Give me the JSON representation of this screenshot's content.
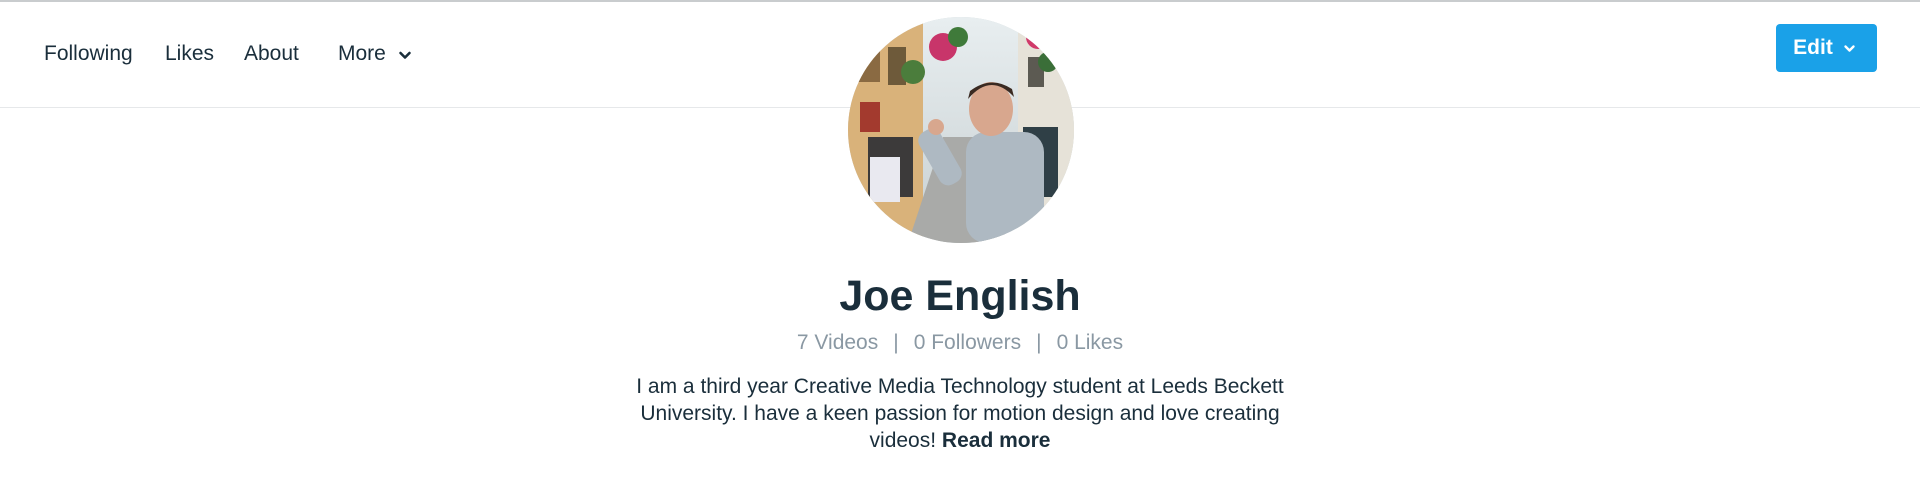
{
  "nav": {
    "following": "Following",
    "likes": "Likes",
    "about": "About",
    "more": "More"
  },
  "header": {
    "edit_label": "Edit"
  },
  "profile": {
    "name": "Joe English",
    "stats": {
      "videos": "7 Videos",
      "followers": "0 Followers",
      "likes": "0 Likes",
      "separator": "|"
    },
    "bio": "I am a third year Creative Media Technology student at Leeds Beckett University. I have a keen passion for motion design and love creating videos!",
    "read_more": "Read more"
  },
  "colors": {
    "accent": "#1aa1e8",
    "text_primary": "#1a2e3b",
    "text_muted": "#8a98a3"
  }
}
